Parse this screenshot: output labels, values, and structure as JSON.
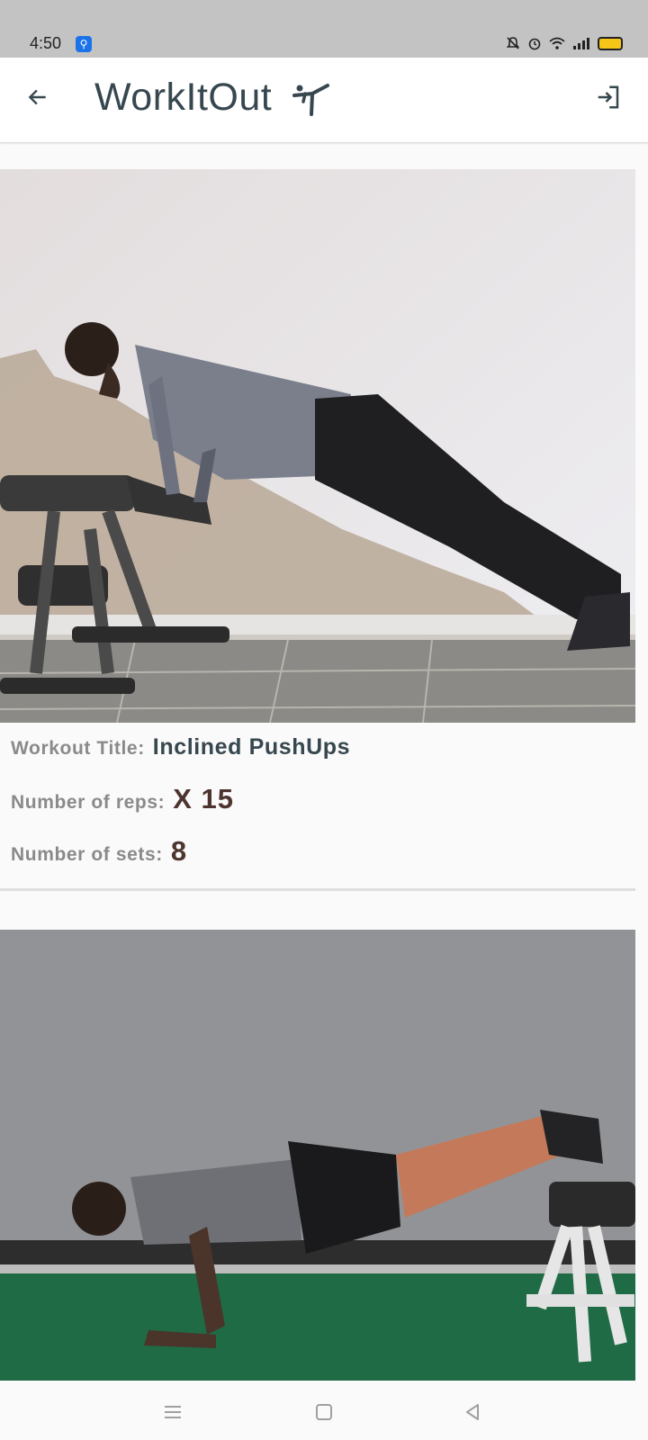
{
  "status_bar": {
    "time": "4:50",
    "icons": [
      "usb-icon",
      "dnd-bell-icon",
      "alarm-icon",
      "wifi-icon",
      "signal-icon",
      "battery-icon"
    ],
    "battery_color": "#f5c518"
  },
  "app_bar": {
    "title": "WorkItOut",
    "brand_icon": "martial-arts-kick-icon",
    "back_icon": "arrow-back-icon",
    "logout_icon": "login-exit-icon",
    "title_color": "#37474f"
  },
  "workouts": [
    {
      "title_label": "Workout Title:",
      "title": "Inclined PushUps",
      "reps_label": "Number of reps:",
      "reps": "X 15",
      "sets_label": "Number of sets:",
      "sets": "8",
      "image_desc": "incline-pushup-photo"
    },
    {
      "image_desc": "decline-pushup-photo"
    }
  ],
  "nav_bar": {
    "buttons": [
      "menu-icon",
      "home-square-icon",
      "back-triangle-icon"
    ]
  },
  "colors": {
    "label": "#8a8a8a",
    "value_title": "#37474f",
    "value_number": "#4e342e",
    "background": "#fafafa"
  }
}
